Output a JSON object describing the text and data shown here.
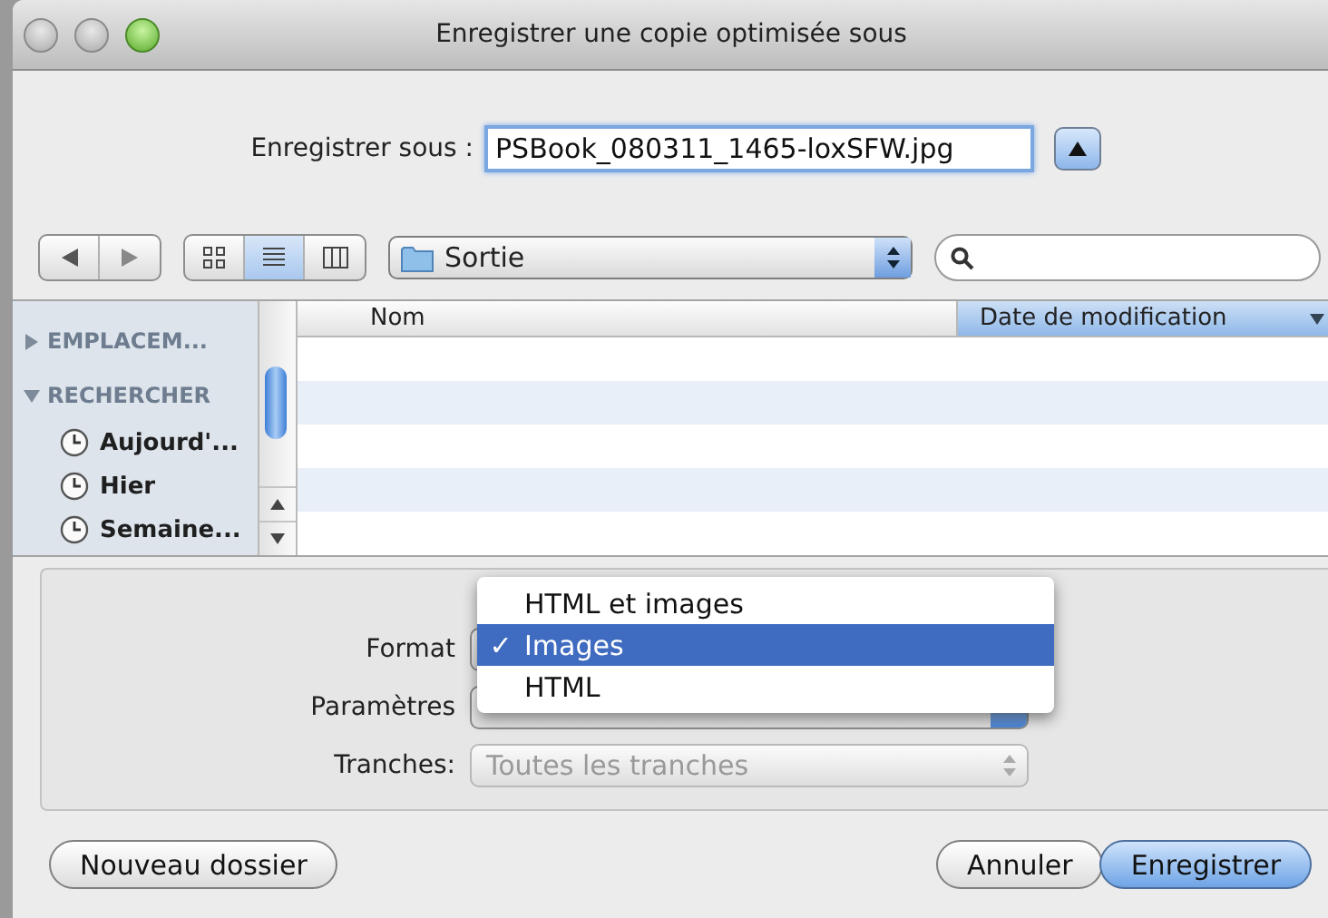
{
  "window": {
    "title": "Enregistrer une copie optimisée sous"
  },
  "save_as": {
    "label": "Enregistrer sous :",
    "value": "PSBook_080311_1465-loxSFW.jpg",
    "expanded": true
  },
  "toolbar": {
    "views": [
      {
        "kind": "icons",
        "selected": false
      },
      {
        "kind": "list",
        "selected": true
      },
      {
        "kind": "columns",
        "selected": false
      }
    ],
    "location": "Sortie"
  },
  "sidebar": {
    "sections": [
      {
        "title": "EMPLACEM...",
        "expanded": false
      },
      {
        "title": "RECHERCHER",
        "expanded": true,
        "items": [
          "Aujourd'...",
          "Hier",
          "Semaine..."
        ]
      }
    ]
  },
  "table": {
    "columns": [
      {
        "label": "Nom",
        "sorted": false
      },
      {
        "label": "Date de modification",
        "sorted": true
      }
    ]
  },
  "options": {
    "format": {
      "label": "Format",
      "check_mark": "✓",
      "menu": [
        {
          "label": "HTML et images",
          "selected": false
        },
        {
          "label": "Images",
          "selected": true
        },
        {
          "label": "HTML",
          "selected": false
        }
      ]
    },
    "parameters": {
      "label": "Paramètres"
    },
    "slices": {
      "label": "Tranches:",
      "value": "Toutes les tranches",
      "disabled": true
    }
  },
  "buttons": [
    {
      "label": "Nouveau dossier",
      "kind": "plain"
    },
    {
      "label": "Annuler",
      "kind": "plain"
    },
    {
      "label": "Enregistrer",
      "kind": "default"
    }
  ]
}
